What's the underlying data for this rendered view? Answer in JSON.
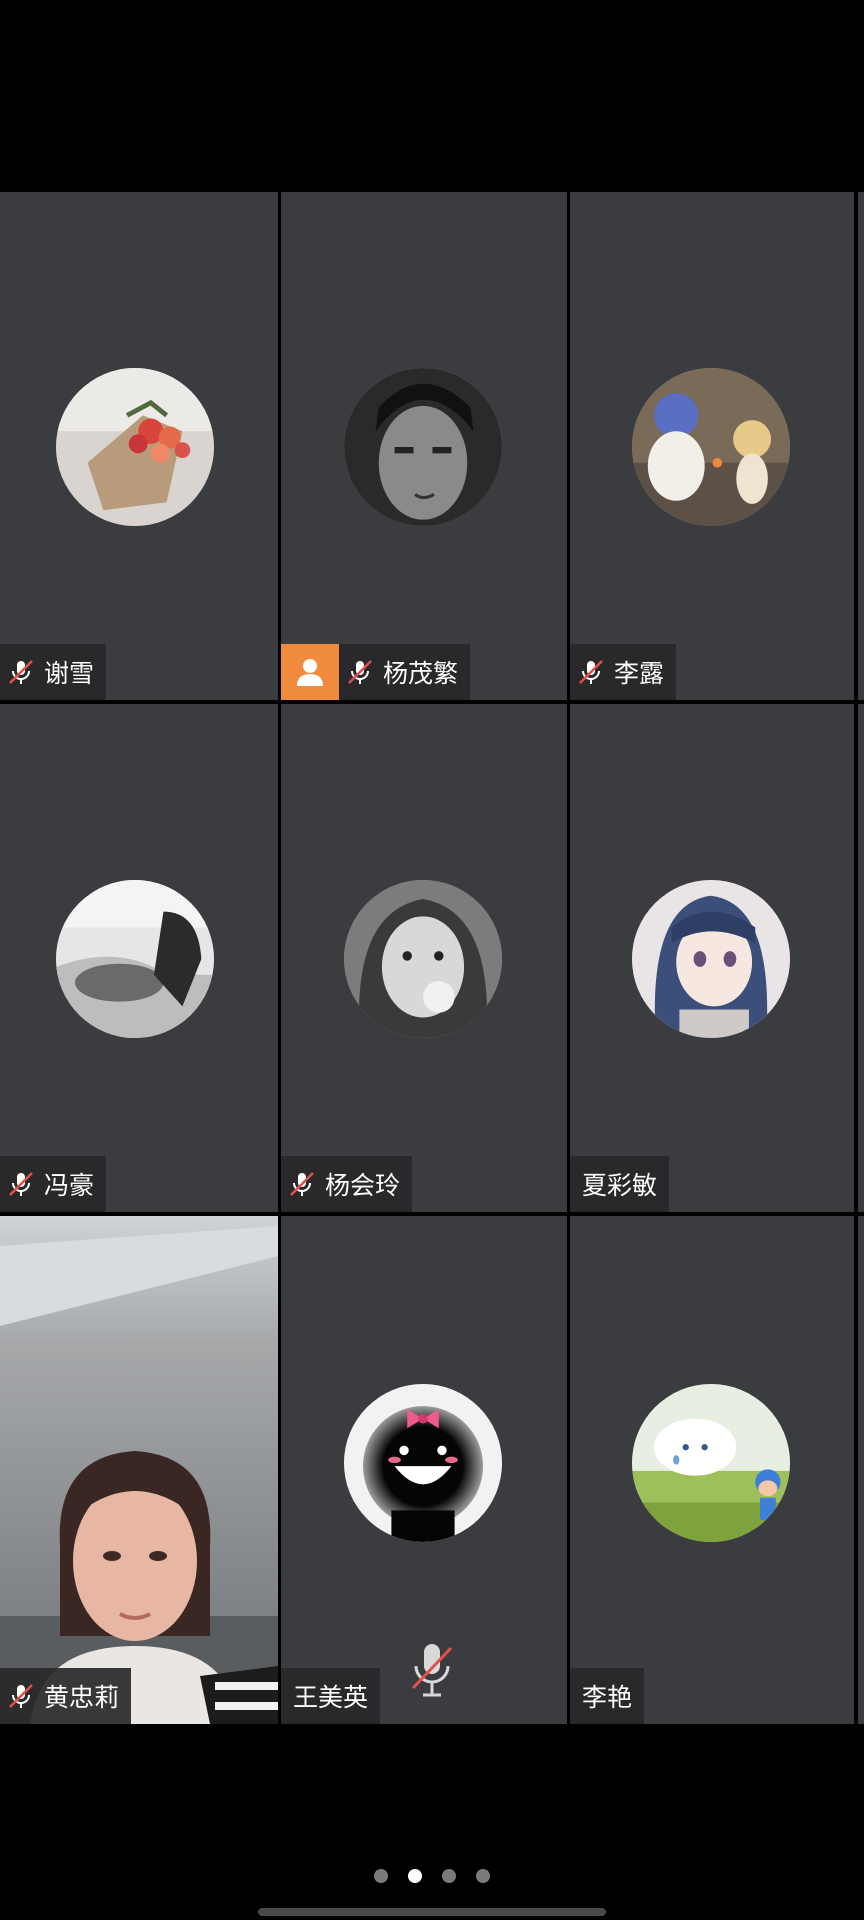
{
  "participants": [
    {
      "name": "谢雪",
      "muted": true,
      "host": false,
      "avatar": "bouquet-photo"
    },
    {
      "name": "杨茂繁",
      "muted": true,
      "host": true,
      "avatar": "man-portrait-bw"
    },
    {
      "name": "李露",
      "muted": true,
      "host": false,
      "avatar": "toy-figures"
    },
    {
      "name": "冯豪",
      "muted": true,
      "host": false,
      "avatar": "cat-bw-photo"
    },
    {
      "name": "杨会玲",
      "muted": true,
      "host": false,
      "avatar": "girl-bubblegum-bw"
    },
    {
      "name": "夏彩敏",
      "muted": false,
      "host": false,
      "avatar": "anime-girl"
    },
    {
      "name": "黄忠莉",
      "muted": true,
      "host": false,
      "avatar": "live-video"
    },
    {
      "name": "王美英",
      "muted": false,
      "host": false,
      "avatar": "black-fuzzball"
    },
    {
      "name": "李艳",
      "muted": false,
      "host": false,
      "avatar": "cloud-toy"
    }
  ],
  "icons": {
    "mute": "mic-off-icon",
    "host": "person-icon",
    "center": "mic-off-icon"
  },
  "pager": {
    "total": 4,
    "active_index": 1
  },
  "colors": {
    "tile_bg": "#3b3c3f",
    "host_badge": "#f08a3c",
    "mute_slash": "#e0524a",
    "page_bg": "#000000"
  }
}
